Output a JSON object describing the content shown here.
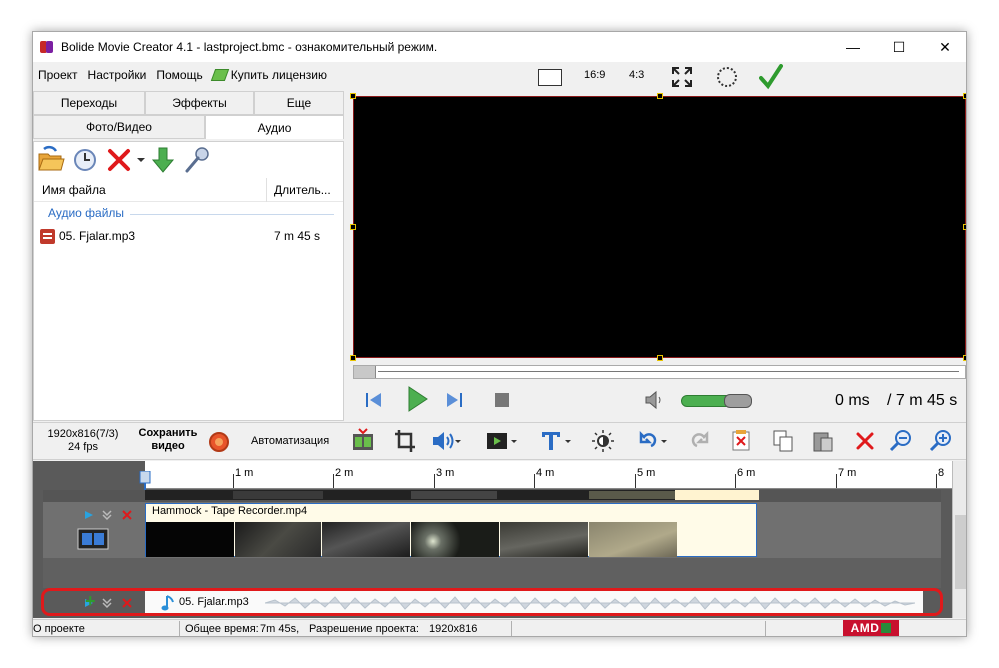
{
  "window": {
    "title": "Bolide Movie Creator 4.1 - lastproject.bmc  - ознакомительный режим.",
    "minimize": "—",
    "maximize": "☐",
    "close": "✕"
  },
  "menu": {
    "items": [
      "Проект",
      "Настройки",
      "Помощь"
    ],
    "license": "Купить лицензию"
  },
  "preview_toolbar": {
    "ratio_169": "16:9",
    "ratio_43": "4:3"
  },
  "left_panel": {
    "tabs_row1": [
      "Переходы",
      "Эффекты",
      "Еще"
    ],
    "tabs_row2": [
      "Фото/Видео",
      "Аудио"
    ],
    "active_tab": "Аудио",
    "columns": {
      "name": "Имя файла",
      "duration": "Длитель..."
    },
    "group": "Аудио файлы",
    "files": [
      {
        "name": "05. Fjalar.mp3",
        "duration": "7 m 45 s"
      }
    ]
  },
  "player": {
    "current_time": "0 ms",
    "total_time": "/ 7 m 45 s",
    "volume_level": 0.85
  },
  "bottom_toolbar": {
    "resolution_line1": "1920x816(7/3)",
    "resolution_line2": "24 fps",
    "save_line1": "Сохранить",
    "save_line2": "видео",
    "automation": "Автоматизация"
  },
  "timeline": {
    "ruler_labels": [
      "1 m",
      "2 m",
      "3 m",
      "4 m",
      "5 m",
      "6 m",
      "7 m",
      "8"
    ],
    "video_clip": "Hammock - Tape Recorder.mp4",
    "audio_clip": "05. Fjalar.mp3"
  },
  "status": {
    "about": "О проекте",
    "total_label": "Общее время:",
    "total_value": "7m 45s,",
    "resolution_label": "Разрешение проекта:",
    "resolution_value": "1920x816",
    "vendor": "AMD"
  },
  "colors": {
    "accent_red": "#e0191b",
    "play_green": "#4caf50",
    "link_blue": "#2a6cc4"
  }
}
